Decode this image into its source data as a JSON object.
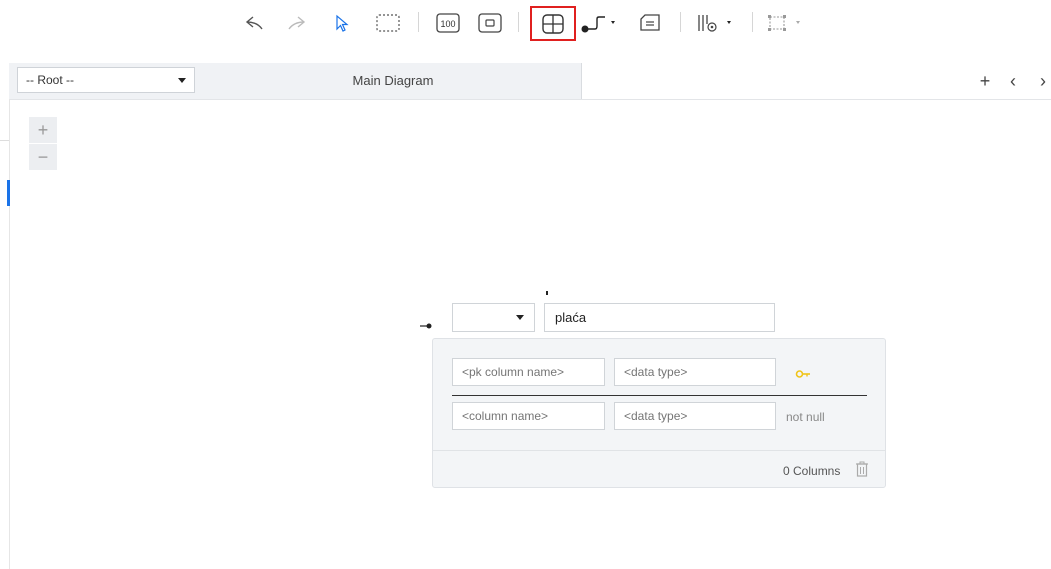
{
  "toolbar": {
    "items": [
      "undo-icon",
      "redo-icon",
      "pointer-icon",
      "marquee-select-icon",
      "zoom-100-icon",
      "fit-icon",
      "table-icon",
      "relation-icon",
      "note-icon",
      "view-options-icon",
      "layout-icon"
    ],
    "zoom_label": "100",
    "active_item": "table-icon",
    "active_color": "#e0201f"
  },
  "tabbar": {
    "root_select": "-- Root --",
    "main_tab": "Main Diagram",
    "add": "+",
    "prev": "‹",
    "next": "›"
  },
  "zoom": {
    "in": "+",
    "out": "−"
  },
  "table": {
    "schema_value": "",
    "name": "plaća",
    "rows": [
      {
        "name_placeholder": "<pk column name>",
        "type_placeholder": "<data type>",
        "marker": "key-icon"
      },
      {
        "name_placeholder": "<column name>",
        "type_placeholder": "<data type>",
        "marker": "not null"
      }
    ],
    "columns_count": "0 Columns",
    "key_color": "#f0c419"
  },
  "accent_color": "#1a73e8"
}
